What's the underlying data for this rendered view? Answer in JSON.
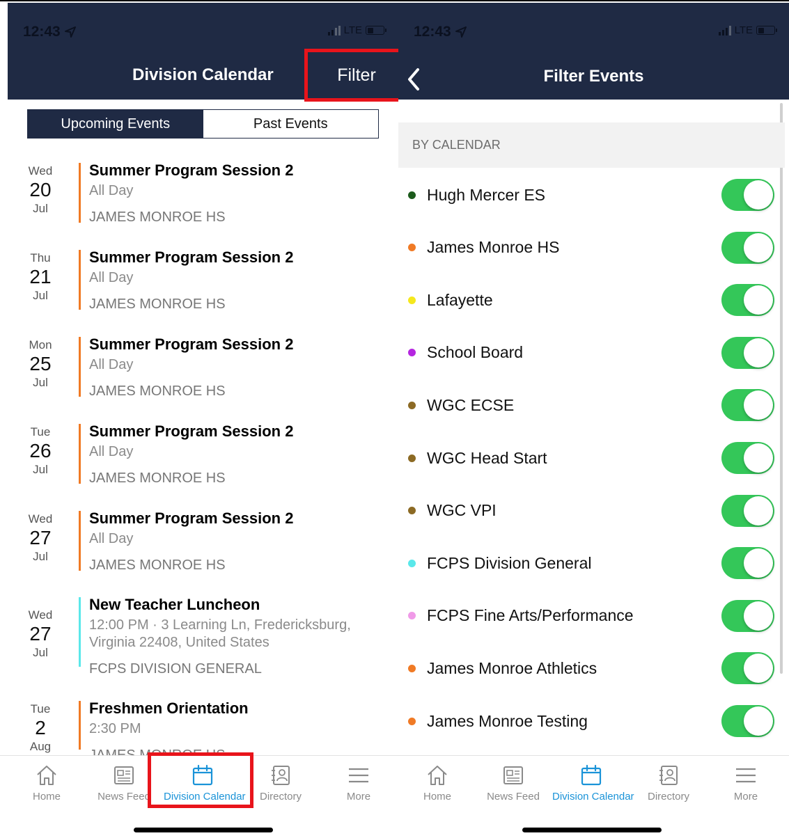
{
  "left": {
    "status": {
      "time": "12:43",
      "network": "LTE"
    },
    "header": {
      "title": "Division Calendar",
      "filter_label": "Filter"
    },
    "segments": {
      "upcoming": "Upcoming Events",
      "past": "Past Events"
    },
    "events": [
      {
        "dow": "Wed",
        "day": "20",
        "month": "Jul",
        "title": "Summer Program Session 2",
        "time": "All Day",
        "location": "JAMES MONROE HS",
        "color": "#f07a25"
      },
      {
        "dow": "Thu",
        "day": "21",
        "month": "Jul",
        "title": "Summer Program Session 2",
        "time": "All Day",
        "location": "JAMES MONROE HS",
        "color": "#f07a25"
      },
      {
        "dow": "Mon",
        "day": "25",
        "month": "Jul",
        "title": "Summer Program Session 2",
        "time": "All Day",
        "location": "JAMES MONROE HS",
        "color": "#f07a25"
      },
      {
        "dow": "Tue",
        "day": "26",
        "month": "Jul",
        "title": "Summer Program Session 2",
        "time": "All Day",
        "location": "JAMES MONROE HS",
        "color": "#f07a25"
      },
      {
        "dow": "Wed",
        "day": "27",
        "month": "Jul",
        "title": "Summer Program Session 2",
        "time": "All Day",
        "location": "JAMES MONROE HS",
        "color": "#f07a25"
      },
      {
        "dow": "Wed",
        "day": "27",
        "month": "Jul",
        "title": "New Teacher Luncheon",
        "time": "12:00 PM · 3 Learning Ln, Fredericksburg, Virginia 22408, United States",
        "location": "FCPS DIVISION GENERAL",
        "color": "#5ae8ea"
      },
      {
        "dow": "Tue",
        "day": "2",
        "month": "Aug",
        "title": "Freshmen Orientation",
        "time": "2:30 PM",
        "location": "JAMES MONROE HS",
        "color": "#f07a25"
      }
    ],
    "tabs": [
      {
        "label": "Home",
        "icon": "home-icon"
      },
      {
        "label": "News Feed",
        "icon": "news-icon"
      },
      {
        "label": "Division Calendar",
        "icon": "calendar-icon"
      },
      {
        "label": "Directory",
        "icon": "directory-icon"
      },
      {
        "label": "More",
        "icon": "menu-icon"
      }
    ]
  },
  "right": {
    "status": {
      "time": "12:43",
      "network": "LTE"
    },
    "header": {
      "title": "Filter Events"
    },
    "section_title": "BY CALENDAR",
    "calendars": [
      {
        "name": "Hugh Mercer ES",
        "color": "#1c5b1c",
        "on": true
      },
      {
        "name": "James Monroe HS",
        "color": "#f07a25",
        "on": true
      },
      {
        "name": "Lafayette",
        "color": "#f5e81d",
        "on": true
      },
      {
        "name": "School Board",
        "color": "#b526e0",
        "on": true
      },
      {
        "name": "WGC ECSE",
        "color": "#8c6a24",
        "on": true
      },
      {
        "name": "WGC Head Start",
        "color": "#8c6a24",
        "on": true
      },
      {
        "name": "WGC VPI",
        "color": "#8c6a24",
        "on": true
      },
      {
        "name": "FCPS Division General",
        "color": "#5ae8ea",
        "on": true
      },
      {
        "name": "FCPS Fine Arts/Performance",
        "color": "#f09ae8",
        "on": true
      },
      {
        "name": "James Monroe Athletics",
        "color": "#f07a25",
        "on": true
      },
      {
        "name": "James Monroe Testing",
        "color": "#f07a25",
        "on": true
      }
    ],
    "tabs": [
      {
        "label": "Home",
        "icon": "home-icon"
      },
      {
        "label": "News Feed",
        "icon": "news-icon"
      },
      {
        "label": "Division Calendar",
        "icon": "calendar-icon"
      },
      {
        "label": "Directory",
        "icon": "directory-icon"
      },
      {
        "label": "More",
        "icon": "menu-icon"
      }
    ]
  },
  "colors": {
    "navy": "#1f2a44",
    "accent": "#1a93d8",
    "toggle_on": "#34c759",
    "highlight": "#e8141b"
  }
}
